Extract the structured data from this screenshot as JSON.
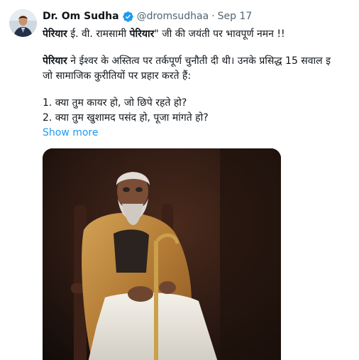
{
  "author": {
    "display_name": "Dr. Om Sudha",
    "handle": "@dromsudhaa",
    "separator": "·",
    "date": "Sep 17"
  },
  "icons": {
    "verified": "verified-badge-icon"
  },
  "colors": {
    "link_blue": "#1d9bf0",
    "secondary_text": "#536471",
    "primary_text": "#0f1419"
  },
  "tweet": {
    "line1_bold1": "पेरियार",
    "line1_text1": " ई. वी. रामसामी ",
    "line1_bold2": "पेरियार",
    "line1_text2": "\" जी की जयंती पर भावपूर्ण नमन !!",
    "line2_bold": "पेरियार",
    "line2_text": " ने ईश्वर के अस्तित्व पर तर्कपूर्ण चुनौती दी थी। उनके प्रसिद्ध 15 सवाल इ",
    "line3_text": "जो सामाजिक कुरीतियों पर प्रहार करते हैं:",
    "question1": "1. क्या तुम कायर हो, जो छिपे रहते हो?",
    "question2": "2. क्या तुम खुशामद पसंद हो, पूजा मांगते हो?",
    "show_more": "Show more"
  }
}
